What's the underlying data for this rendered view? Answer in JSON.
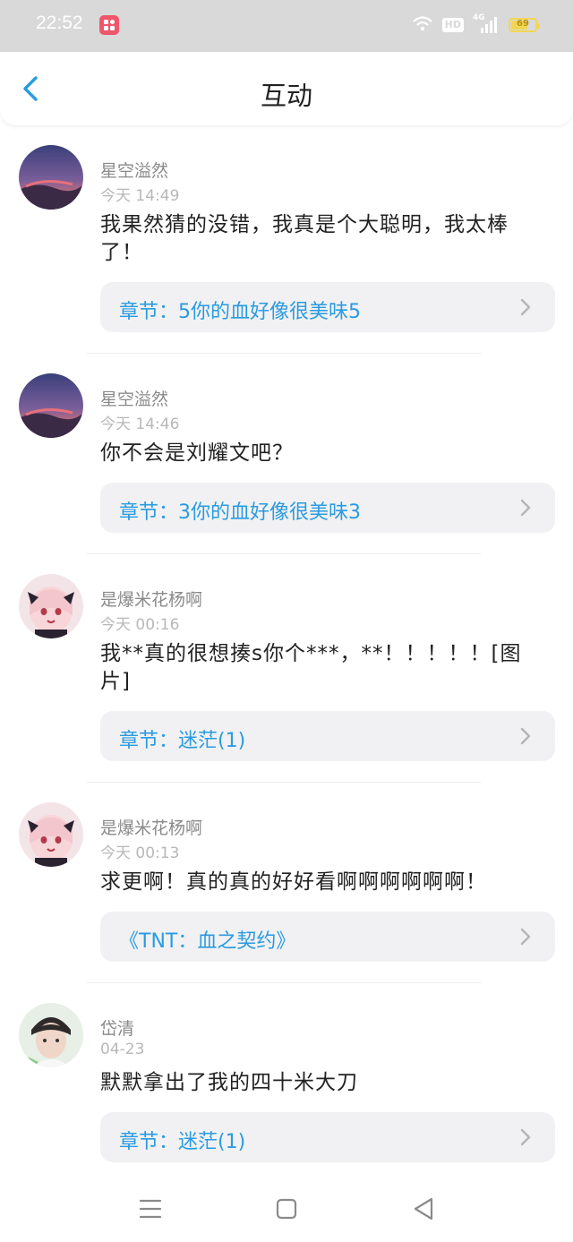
{
  "status_bar": {
    "time": "22:52",
    "hd": "HD",
    "network": "4G",
    "battery": "69",
    "battery_level": 0.69
  },
  "header": {
    "title": "互动"
  },
  "feed": [
    {
      "user": "星空溢然",
      "time": "今天 14:49",
      "text": "我果然猜的没错，我真是个大聪明，我太棒了！",
      "chapter": "章节：5你的血好像很美味5"
    },
    {
      "user": "星空溢然",
      "time": "今天 14:46",
      "text": "你不会是刘耀文吧？",
      "chapter": "章节：3你的血好像很美味3"
    },
    {
      "user": "是爆米花杨啊",
      "time": "今天 00:16",
      "text": "我**真的很想揍s你个***，**！！！！！[图片]",
      "chapter": "章节：迷茫(1)"
    },
    {
      "user": "是爆米花杨啊",
      "time": "今天 00:13",
      "text": "求更啊！真的真的好好看啊啊啊啊啊啊！",
      "chapter": "《TNT：血之契约》"
    },
    {
      "user": "岱清",
      "time": "04-23",
      "text": "默默拿出了我的四十米大刀",
      "chapter": "章节：迷茫(1)"
    }
  ],
  "colors": {
    "accent": "#2a9be0",
    "status_bar_bg": "#d9d9d9",
    "chapter_bg": "#f1f1f3",
    "battery": "#f2d650"
  }
}
